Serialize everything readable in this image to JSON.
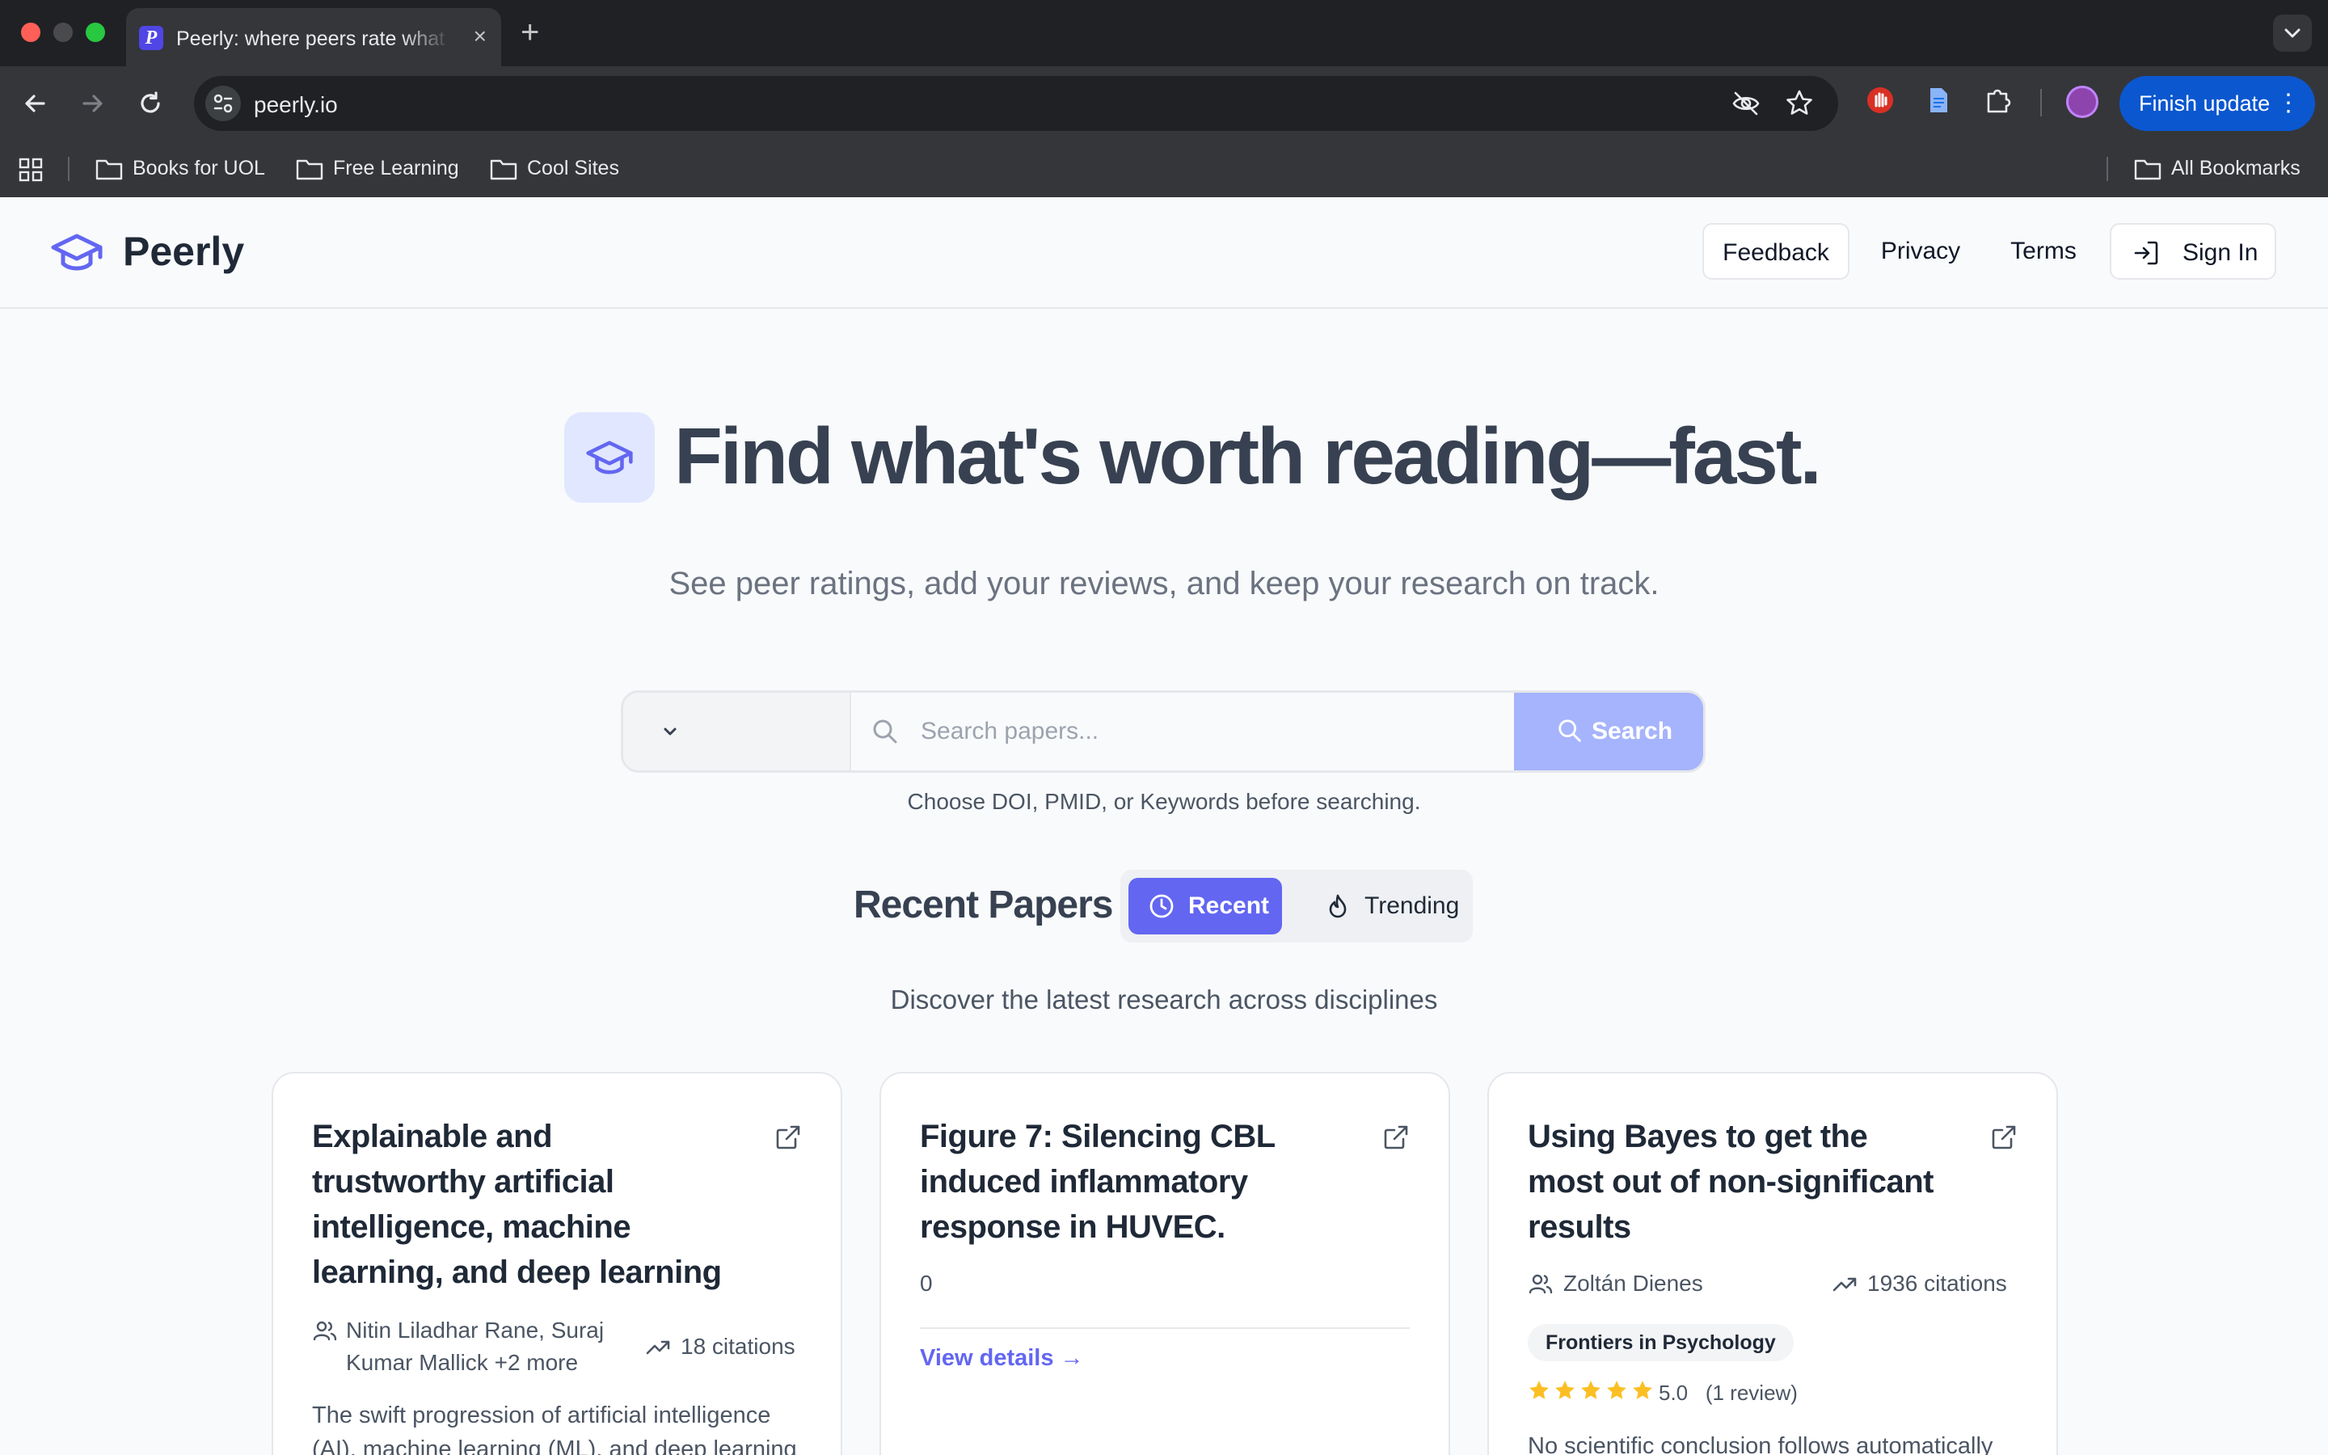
{
  "browser": {
    "tab_title": "Peerly: where peers rate what matters",
    "tab_close": "×",
    "new_tab": "+",
    "url": "peerly.io",
    "update_label": "Finish update",
    "update_menu": "⋮",
    "bookmarks": [
      "Books for UOL",
      "Free Learning",
      "Cool Sites"
    ],
    "all_bookmarks": "All Bookmarks"
  },
  "header": {
    "brand": "Peerly",
    "nav": [
      "Feedback",
      "Privacy",
      "Terms"
    ],
    "sign_in": "Sign In"
  },
  "hero": {
    "title": "Find what's worth reading—fast.",
    "subtitle": "See peer ratings, add your reviews, and keep your research on track."
  },
  "search": {
    "select_value": "",
    "placeholder": "Search papers...",
    "button": "Search",
    "hint": "Choose DOI, PMID, or Keywords before searching."
  },
  "papers_section": {
    "title": "Recent Papers",
    "tabs": [
      "Recent",
      "Trending"
    ],
    "active_tab": "Recent",
    "subtitle": "Discover the latest research across disciplines"
  },
  "papers": [
    {
      "title": "Explainable and trustworthy artificial intelligence, machine learning, and deep learning",
      "authors": "Nitin Liladhar Rane, Suraj Kumar Mallick +2 more",
      "citations": "18 citations",
      "abstract": "The swift progression of artificial intelligence (AI), machine learning (ML), and deep learning"
    },
    {
      "title": "Figure 7: Silencing CBL induced inflammatory response in HUVEC.",
      "count": "0",
      "link": "View details →"
    },
    {
      "title": "Using Bayes to get the most out of non-significant results",
      "authors": "Zoltán Dienes",
      "citations": "1936 citations",
      "journal": "Frontiers in Psychology",
      "rating_value": 5.0,
      "rating": "5.0",
      "reviews": "(1 review)",
      "abstract": "No scientific conclusion follows automatically"
    }
  ],
  "colors": {
    "accent": "#6366f1",
    "accent_light": "#a5b4fc",
    "star": "#fbbf24",
    "title_text": "#374151"
  }
}
